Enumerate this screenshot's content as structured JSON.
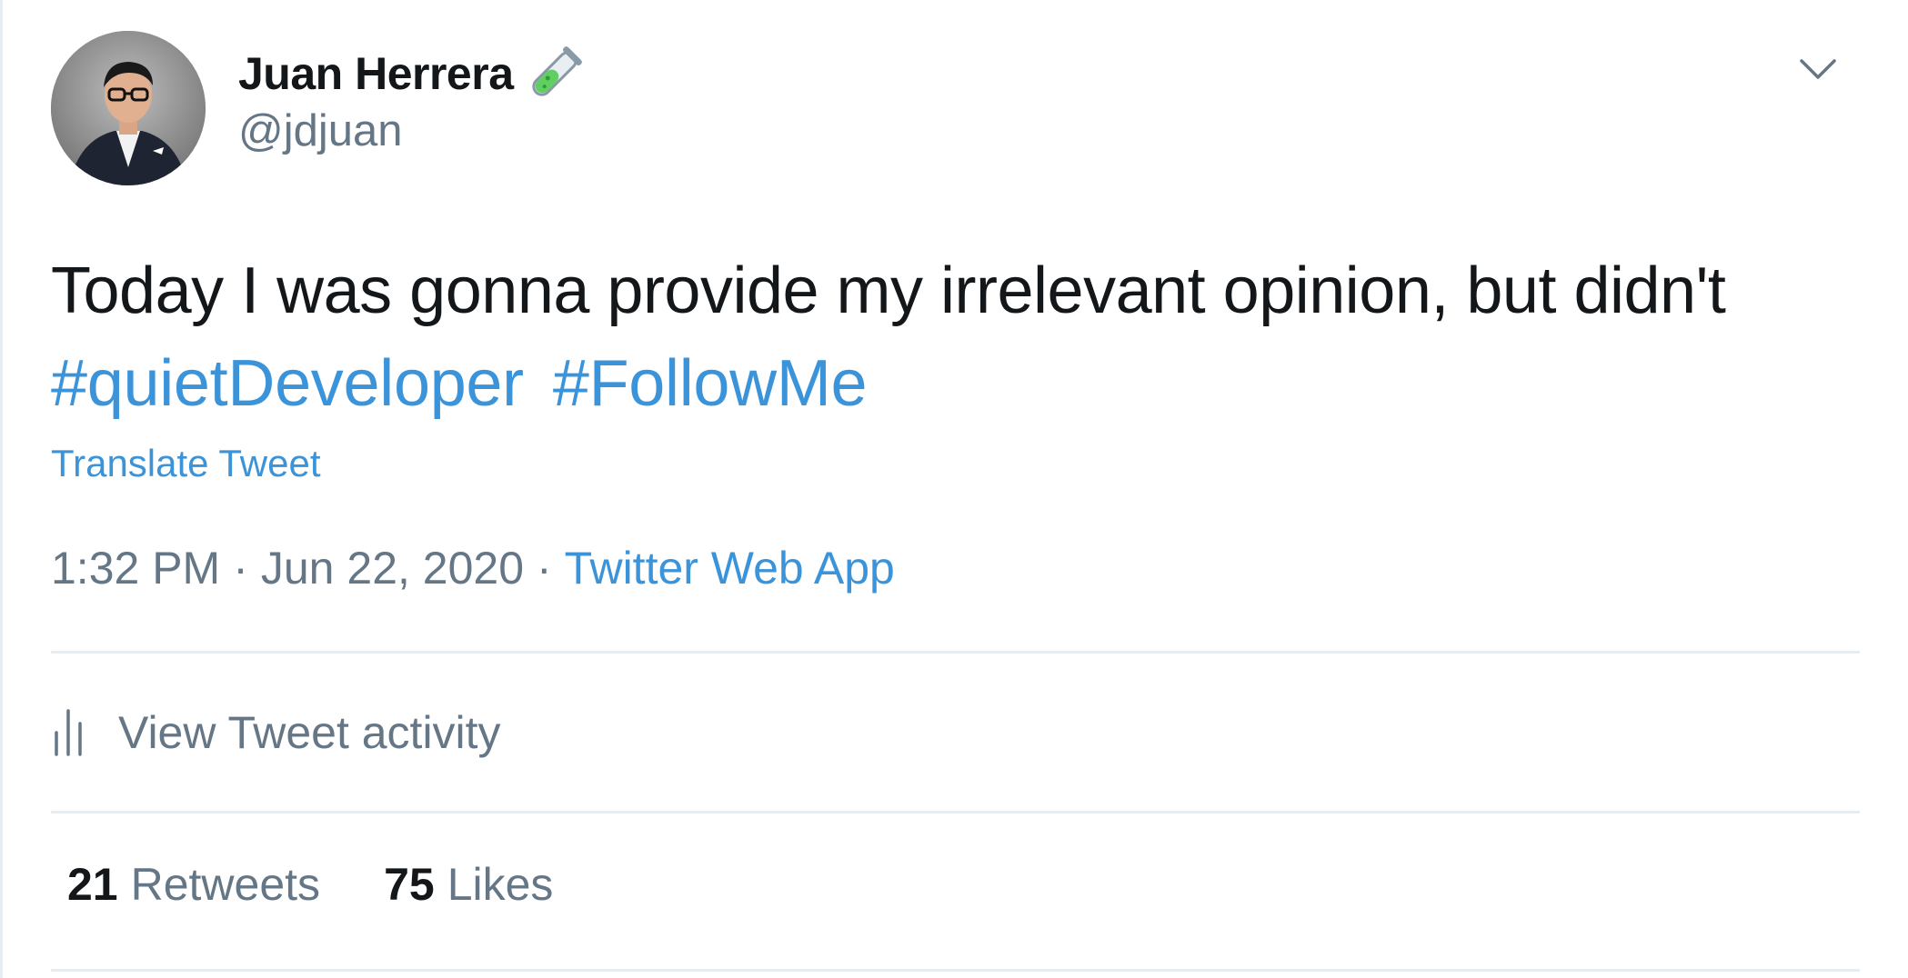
{
  "author": {
    "display_name": "Juan Herrera",
    "handle": "@jdjuan",
    "badge_icon": "test-tube-icon"
  },
  "tweet": {
    "text": "Today I was gonna provide my irrelevant opinion, but didn't",
    "hashtags": [
      "#quietDeveloper",
      "#FollowMe"
    ],
    "translate_label": "Translate Tweet",
    "time": "1:32 PM",
    "date": "Jun 22, 2020",
    "separator": "·",
    "source": "Twitter Web App"
  },
  "activity": {
    "label": "View Tweet activity",
    "icon": "bar-chart-icon"
  },
  "stats": {
    "retweets_count": "21",
    "retweets_label": "Retweets",
    "likes_count": "75",
    "likes_label": "Likes"
  },
  "colors": {
    "link": "#3b94d9",
    "text": "#14171a",
    "secondary": "#657786",
    "divider": "#e6ecf0"
  }
}
